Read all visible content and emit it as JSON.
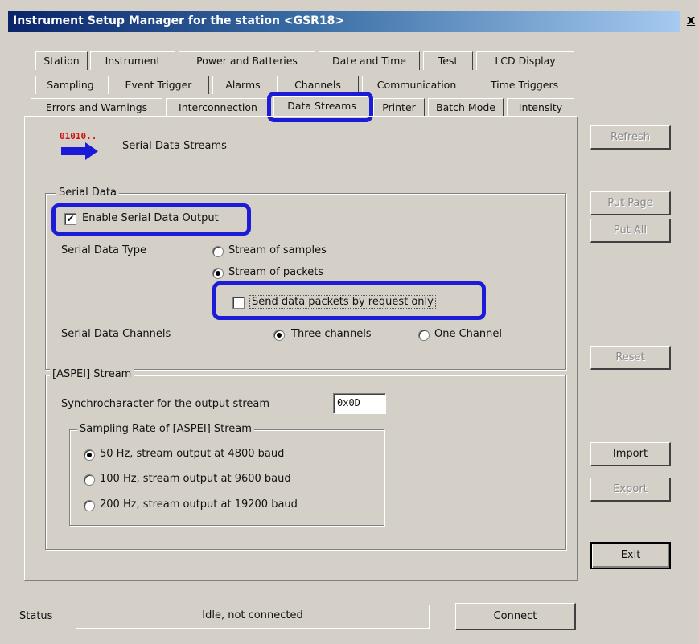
{
  "window": {
    "title": "Instrument Setup Manager for the station <GSR18>",
    "close_symbol": "x"
  },
  "tabs": {
    "row1": [
      "Station",
      "Instrument",
      "Power and Batteries",
      "Date and Time",
      "Test",
      "LCD Display"
    ],
    "row2": [
      "Sampling",
      "Event Trigger",
      "Alarms",
      "Channels",
      "Communication",
      "Time Triggers"
    ],
    "row3": [
      "Errors and Warnings",
      "Interconnection",
      "Data Streams",
      "Printer",
      "Batch Mode",
      "Intensity"
    ],
    "active": "Data Streams"
  },
  "header": {
    "icon_text": "01010..",
    "icon_name": "data-stream-arrow-icon",
    "title": "Serial Data Streams"
  },
  "serial_data": {
    "group_label": "Serial Data",
    "enable_label": "Enable Serial Data Output",
    "enable_checked": true,
    "type_label": "Serial Data Type",
    "type_options": [
      "Stream of samples",
      "Stream of packets"
    ],
    "type_selected": "Stream of packets",
    "request_only_label": "Send data packets by request only",
    "request_only_checked": false,
    "channels_label": "Serial Data Channels",
    "channel_options": [
      "Three channels",
      "One Channel"
    ],
    "channel_selected": "Three channels"
  },
  "aspei": {
    "group_label": "[ASPEI] Stream",
    "sync_label": "Synchrocharacter for the output stream",
    "sync_value": "0x0D",
    "rate_group_label": "Sampling Rate of [ASPEI] Stream",
    "rate_options": [
      "50 Hz, stream output at 4800 baud",
      "100 Hz, stream output at 9600 baud",
      "200 Hz, stream output at 19200 baud"
    ],
    "rate_selected": "50 Hz, stream output at 4800 baud"
  },
  "side_buttons": {
    "refresh": "Refresh",
    "put_page": "Put Page",
    "put_all": "Put All",
    "reset": "Reset",
    "import": "Import",
    "export": "Export",
    "exit": "Exit"
  },
  "status": {
    "label": "Status",
    "value": "Idle, not connected",
    "connect": "Connect"
  },
  "colors": {
    "face": "#d4d0c8",
    "highlight_outline": "#1c1cd6",
    "title_gradient_start": "#0a246a"
  }
}
